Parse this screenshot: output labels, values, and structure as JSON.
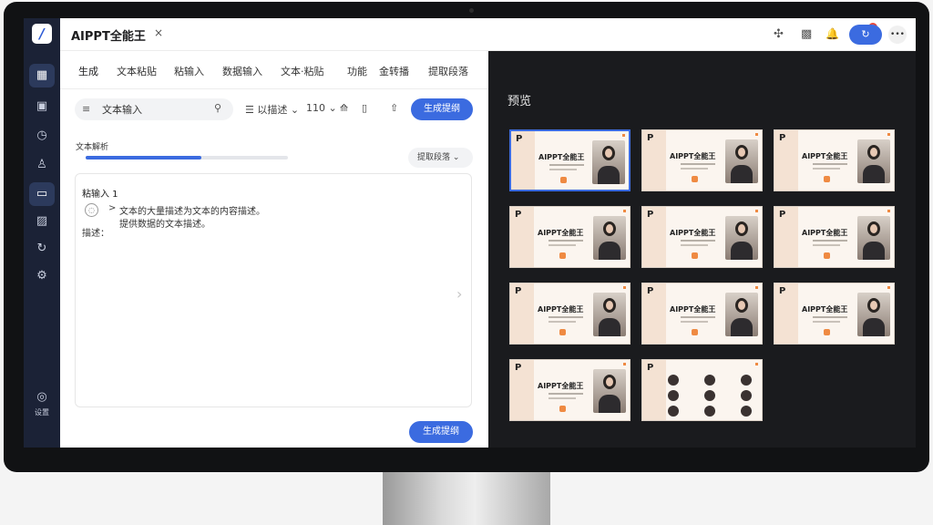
{
  "app": {
    "title": "AIPPT全能王",
    "close_label": "×"
  },
  "rail": {
    "items": [
      {
        "name": "rail-home-icon",
        "glyph": "▦"
      },
      {
        "name": "rail-template-icon",
        "glyph": "▣"
      },
      {
        "name": "rail-time-icon",
        "glyph": "◷"
      },
      {
        "name": "rail-user-icon",
        "glyph": "♙"
      },
      {
        "name": "rail-briefcase-icon",
        "glyph": "▭"
      },
      {
        "name": "rail-image-icon",
        "glyph": "▨"
      },
      {
        "name": "rail-refresh-icon",
        "glyph": "↻"
      },
      {
        "name": "rail-settings-icon",
        "glyph": "⚙"
      }
    ],
    "bottom": {
      "glyph": "◎",
      "label": "设置"
    }
  },
  "topbar": {
    "icons": {
      "pin": "✣",
      "gift": "▩",
      "bell": "🔔",
      "primary": "↻",
      "more": "•••"
    },
    "notif_count": "1"
  },
  "tabs": [
    "生成",
    "文本粘贴",
    "粘输入",
    "数据输入",
    "文本·粘贴",
    "功能",
    "金转播",
    "提取段落"
  ],
  "search": {
    "filter_glyph": "≡",
    "value": "文本输入",
    "placeholder": "文本输入"
  },
  "toolbar": {
    "layout_label": "☰ 以描述 ⌄",
    "size_label": "110 ⌄",
    "format_glyph": "⟰",
    "copy_glyph": "▯",
    "export_glyph": "⇧",
    "generate_top": "生成提纲"
  },
  "progress": {
    "label": "文本解析",
    "value": 0.57
  },
  "select": {
    "label": "提取段落 ⌄"
  },
  "text_area": {
    "input_label": "粘输入 1",
    "icon_glyph": "◌",
    "chevron": ">",
    "line1": "文本的大量描述为文本的内容描述。",
    "line2": "提供数据的文本描述。",
    "note": "描述：",
    "right_chevron": "›"
  },
  "generate_bottom": "生成提纲",
  "preview": {
    "title": "预览",
    "slide_prefix": "P",
    "slide_title": "AIPPT全能王",
    "selected_index": 0
  }
}
